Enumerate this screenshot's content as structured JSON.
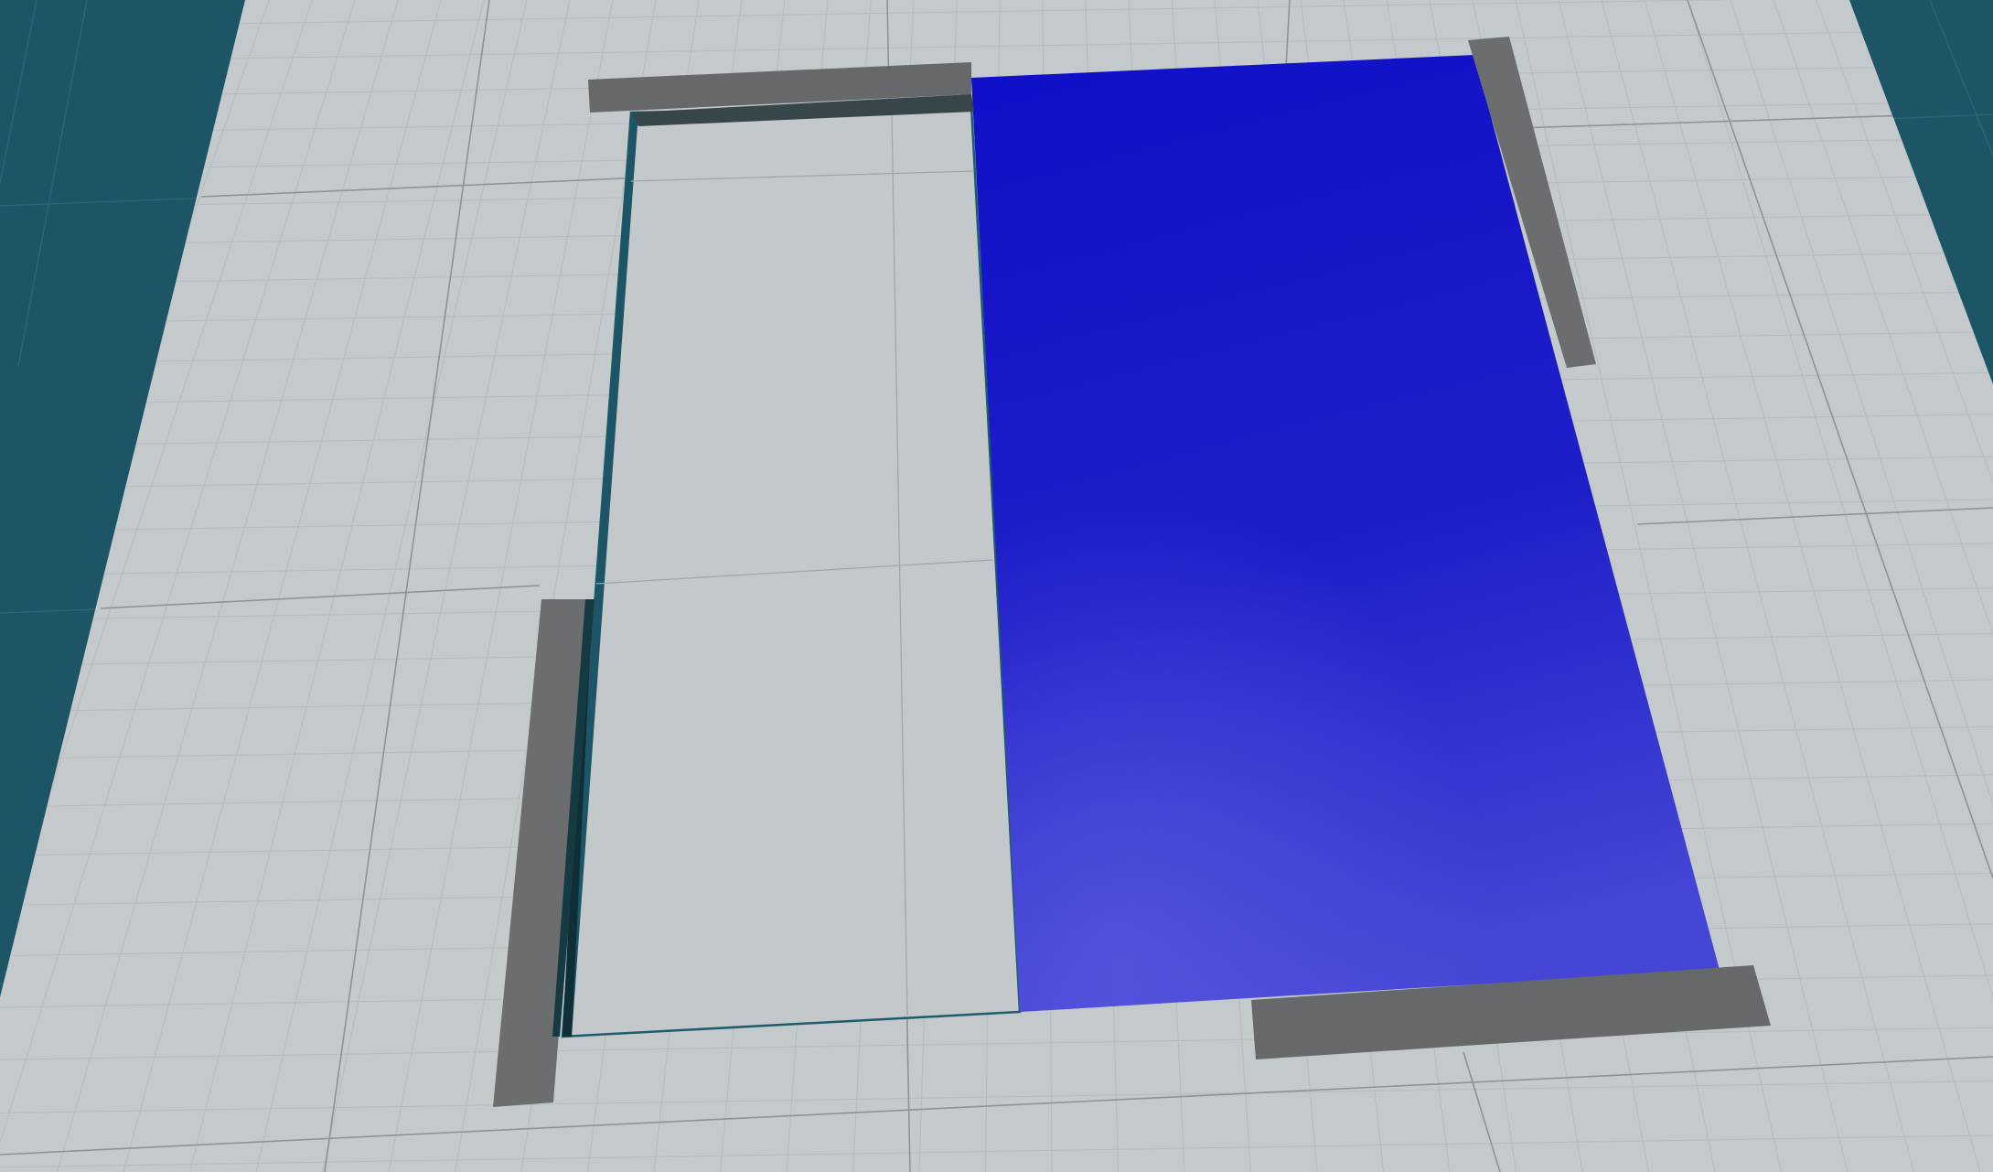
{
  "scene": {
    "colors": {
      "void_background": "#1d5566",
      "void_grid_line": "#2c6b7c",
      "floor": "#c4c9cc",
      "floor_grid_minor": "#b3b8bb",
      "floor_grid_major": "#8f9497",
      "selection_outline": "#1f5c6b",
      "bracket_top": "#66686a",
      "bracket_shadow": "#36464a",
      "bracket_side": "#6b6d6f",
      "panel_blue_top": "#1010c8",
      "panel_blue_bottom": "#4848d8"
    },
    "objects": [
      "floor-plane",
      "empty-panel-outline",
      "blue-panel",
      "corner-bracket-top-left",
      "corner-bracket-top-right",
      "corner-bracket-bottom-left",
      "corner-bracket-bottom-right"
    ]
  }
}
